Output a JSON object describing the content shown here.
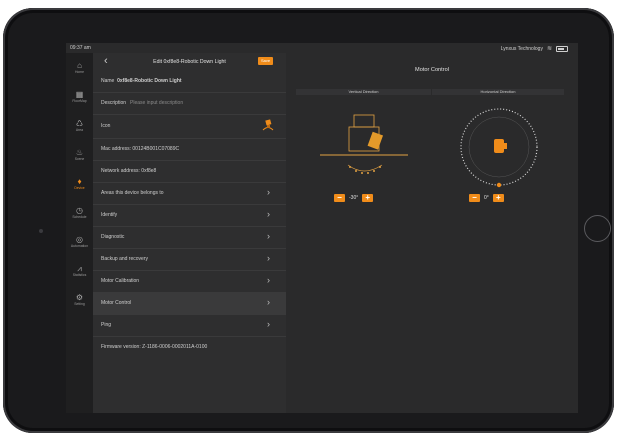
{
  "statusbar": {
    "time": "09:37 am",
    "carrier": "Lynxus Technology"
  },
  "rail": {
    "items": [
      {
        "label": "Home",
        "icon": "home-icon",
        "glyph": "⌂"
      },
      {
        "label": "FloorMap",
        "icon": "floormap-icon",
        "glyph": "▦"
      },
      {
        "label": "Area",
        "icon": "area-icon",
        "glyph": "♺"
      },
      {
        "label": "Scene",
        "icon": "scene-icon",
        "glyph": "♨"
      },
      {
        "label": "Device",
        "icon": "device-icon",
        "glyph": "♦"
      },
      {
        "label": "Schedule",
        "icon": "schedule-icon",
        "glyph": "◷"
      },
      {
        "label": "Automation",
        "icon": "automation-icon",
        "glyph": "◎"
      },
      {
        "label": "Statistics",
        "icon": "statistics-icon",
        "glyph": "⩘"
      },
      {
        "label": "Setting",
        "icon": "setting-icon",
        "glyph": "⚙"
      }
    ],
    "active": "Device"
  },
  "left": {
    "title": "Edit 0xf8e8-Robotic Down Light",
    "save_label": "Save",
    "name_label": "Name",
    "name_value": "0xf8e8-Robotic Down Light",
    "description_label": "Description",
    "description_placeholder": "Please input description",
    "icon_label": "Icon",
    "mac": "Mac address: 00124B001C07089C",
    "network": "Network address: 0xf8e8",
    "areas": "Areas this device belongs to",
    "identify": "Identify",
    "diagnostic": "Diagnostic",
    "backup": "Backup and recovery",
    "motor_calibration": "Motor Calibration",
    "motor_control": "Motor Control",
    "ping": "Ping",
    "firmware": "Firmware version: Z-1186-0006-0002011A-0100"
  },
  "right": {
    "title": "Motor Control",
    "vertical_label": "Vertical Direction",
    "horizontal_label": "Horizontal Direction",
    "vertical_value": "-30°",
    "horizontal_value": "0°",
    "minus": "−",
    "plus": "+"
  },
  "colors": {
    "accent": "#f08c1a",
    "panel": "#2e2e2f",
    "background": "#2a2a2b"
  }
}
